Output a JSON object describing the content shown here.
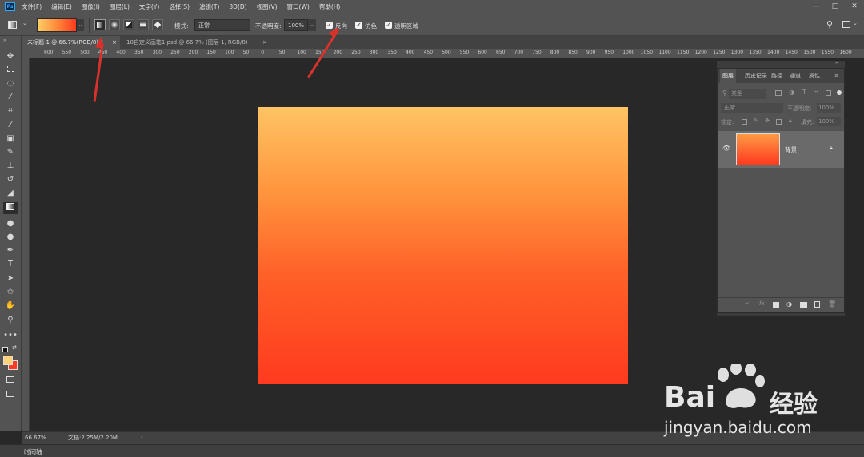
{
  "menubar": {
    "logo": "Ps",
    "items": [
      "文件(F)",
      "编辑(E)",
      "图像(I)",
      "图层(L)",
      "文字(Y)",
      "选择(S)",
      "滤镜(T)",
      "3D(D)",
      "视图(V)",
      "窗口(W)",
      "帮助(H)"
    ],
    "min": "—",
    "max": "□",
    "close": "✕"
  },
  "options": {
    "mode_label": "模式:",
    "mode_value": "正常",
    "opacity_label": "不透明度:",
    "opacity_value": "100%",
    "reverse_label": "反向",
    "dither_label": "仿色",
    "transparency_label": "透明区域",
    "gradient_colors": [
      "#ffcf66",
      "#ff3a1f"
    ]
  },
  "tabs": [
    {
      "label": "未标题-1 @ 66.7%(RGB/8) *",
      "close": "×"
    },
    {
      "label": "10自定义画笔1.psd @ 66.7% (图层 1, RGB/8)",
      "close": "×"
    }
  ],
  "ruler": {
    "h_ticks": [
      "600",
      "550",
      "500",
      "450",
      "400",
      "350",
      "300",
      "250",
      "200",
      "150",
      "100",
      "50",
      "0",
      "50",
      "100",
      "150",
      "200",
      "250",
      "300",
      "350",
      "400",
      "450",
      "500",
      "550",
      "600",
      "650",
      "700",
      "750",
      "800",
      "850",
      "900",
      "950",
      "1000",
      "1050",
      "1100",
      "1150",
      "1200",
      "1250",
      "1300",
      "1350",
      "1400",
      "1450",
      "1500",
      "1550",
      "1600"
    ]
  },
  "canvas": {
    "gradient_top": "#ffc464",
    "gradient_bottom": "#ff3a1f"
  },
  "layers_panel": {
    "tabs": [
      "图层",
      "历史记录",
      "路径",
      "通道",
      "属性"
    ],
    "filter_placeholder": "类型",
    "blend_mode": "正常",
    "opacity_label": "不透明度:",
    "opacity_value": "100%",
    "lock_label": "锁定:",
    "fill_label": "填充:",
    "fill_value": "100%",
    "layer_name": "背景",
    "footer_icons": [
      "link-icon",
      "fx-icon",
      "mask-icon",
      "adjustment-icon",
      "folder-icon",
      "new-layer-icon",
      "trash-icon"
    ]
  },
  "status": {
    "zoom": "66.67%",
    "doc": "文档:2.25M/2.20M",
    "arrow": "›"
  },
  "timeline": {
    "label": "时间轴"
  },
  "watermark": {
    "brand": "Bai",
    "brand2": "经验",
    "url": "jingyan.baidu.com"
  },
  "colors": {
    "accent_arrow": "#d8322b",
    "ps_blue": "#31a8ff"
  }
}
